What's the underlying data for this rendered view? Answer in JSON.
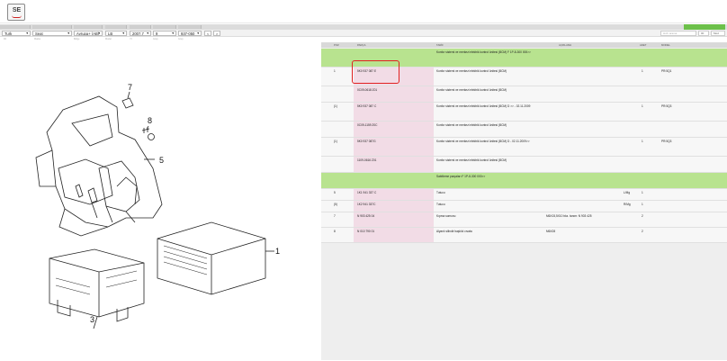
{
  "app": {
    "logo_text": "SE"
  },
  "status_tag": "",
  "filters": [
    {
      "name": "language",
      "value": "Turk"
    },
    {
      "name": "brand",
      "value": "Seat"
    },
    {
      "name": "region",
      "value": "Avrupa+ (AB)"
    },
    {
      "name": "model",
      "value": "LB"
    },
    {
      "name": "year",
      "value": "2007.7"
    },
    {
      "name": "group",
      "value": "9"
    },
    {
      "name": "part-group",
      "value": "937-050"
    }
  ],
  "nav_buttons": {
    "prev": "<",
    "next": ">"
  },
  "search": {
    "placeholder": "Hızlı arama",
    "btn1": "00",
    "btn2": "Mod"
  },
  "hints": [
    "Dil",
    "Marka",
    "Bölge",
    "Model",
    "Yıl",
    "Grup",
    "Grup"
  ],
  "table": {
    "headers": [
      "POZ",
      "PARÇA",
      "TARİF",
      "AÇIKLAMA",
      "ADET",
      "MODEL"
    ],
    "rows": [
      {
        "kind": "green",
        "pos": "",
        "part": "",
        "desc": "Konfor sistemi ve merkezi elektrik kontrol ünitesi (BCM) F 1P-8-300 000>>",
        "note": "",
        "qty": "",
        "model": ""
      },
      {
        "kind": "white",
        "pos": "1",
        "part": "5K0 937 087 E",
        "desc": "Konfor sistemi ve merkezi elektrik kontrol ünitesi (BCM)",
        "note": "",
        "qty": "1",
        "model": "PR:5Q1"
      },
      {
        "kind": "white",
        "pos": "",
        "part": "0C09-0618 Z01",
        "desc": "Konfor sistemi ve merkezi elektrik kontrol ünitesi (BCM)",
        "note": "",
        "qty": "",
        "model": ""
      },
      {
        "kind": "white",
        "pos": "(1)",
        "part": "5K0 937 087 C",
        "desc": "Konfor sistemi ve merkezi elektrik kontrol ünitesi (BCM) D >> - 02.11.2009",
        "note": "",
        "qty": "1",
        "model": "PR:5Q3"
      },
      {
        "kind": "white",
        "pos": "",
        "part": "0C09-1159 Z0C",
        "desc": "Konfor sistemi ve merkezi elektrik kontrol ünitesi (BCM)",
        "note": "",
        "qty": "",
        "model": ""
      },
      {
        "kind": "white",
        "pos": "(1)",
        "part": "5K0 937 087G",
        "desc": "Konfor sistemi ve merkezi elektrik kontrol ünitesi (BCM) D - 02.11.2009>>",
        "note": "",
        "qty": "1",
        "model": "PR:5Q3"
      },
      {
        "kind": "white",
        "pos": "",
        "part": "1109-0616 Z01",
        "desc": "Konfor sistemi ve merkezi elektrik kontrol ünitesi (BCM)",
        "note": "",
        "qty": "",
        "model": ""
      },
      {
        "kind": "green",
        "pos": "",
        "part": "",
        "desc": "Sabitleme parçaları F 1P-8-300 000>>",
        "note": "",
        "qty": "",
        "model": ""
      },
      {
        "kind": "white",
        "pos": "5",
        "part": "1K1 941 337 C",
        "desc": "Tutucu",
        "note": "",
        "qty": "1",
        "model": "",
        "extra": "L/Mg"
      },
      {
        "kind": "white",
        "pos": "(5)",
        "part": "1K2 941 337C",
        "desc": "Tutucu",
        "note": "",
        "qty": "1",
        "model": "",
        "extra": "R/Mg"
      },
      {
        "kind": "white",
        "pos": "7",
        "part": "N 903 425 04",
        "desc": "Kıpma somunu",
        "note": "M6X15,5X10 bkz. tanım: N 903 425",
        "qty": "2",
        "model": ""
      },
      {
        "kind": "white",
        "pos": "8",
        "part": "N 010 790 01",
        "desc": "Alyanlı silindir başlıklı cıvata",
        "note": "M6X28",
        "qty": "2",
        "model": ""
      }
    ]
  },
  "diagram": {
    "callouts": [
      "7",
      "8",
      "5",
      "1",
      "3"
    ],
    "watermark": ""
  }
}
